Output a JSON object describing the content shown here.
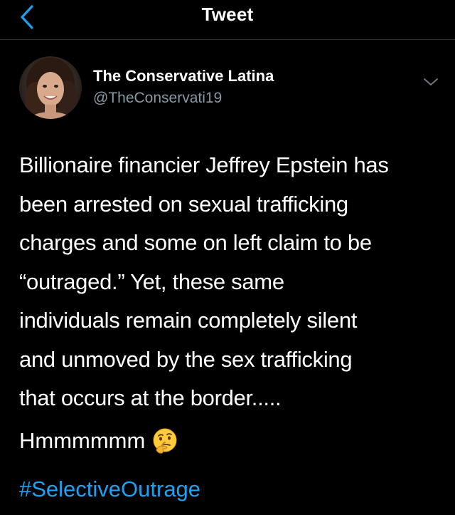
{
  "header": {
    "title": "Tweet",
    "back_icon": "chevron-left-icon",
    "accent_color": "#1da1f2"
  },
  "author": {
    "name": "The Conservative Latina",
    "handle": "@TheConservati19",
    "avatar_icon": "avatar-photo",
    "menu_icon": "chevron-down-icon"
  },
  "tweet": {
    "lines": [
      "Billionaire financier Jeffrey Epstein has",
      "been arrested on sexual trafficking",
      "charges and some on left claim to be",
      "“outraged.” Yet, these same",
      "individuals remain completely silent",
      "and unmoved by the sex trafficking",
      "that occurs at the border....."
    ],
    "reaction": "Hmmmmmm",
    "reaction_emoji": "thinking-face-icon",
    "hashtag": "#SelectiveOutrage"
  },
  "colors": {
    "background": "#000000",
    "text": "#ffffff",
    "secondary_text": "#8899a6",
    "link": "#1da1f2"
  }
}
